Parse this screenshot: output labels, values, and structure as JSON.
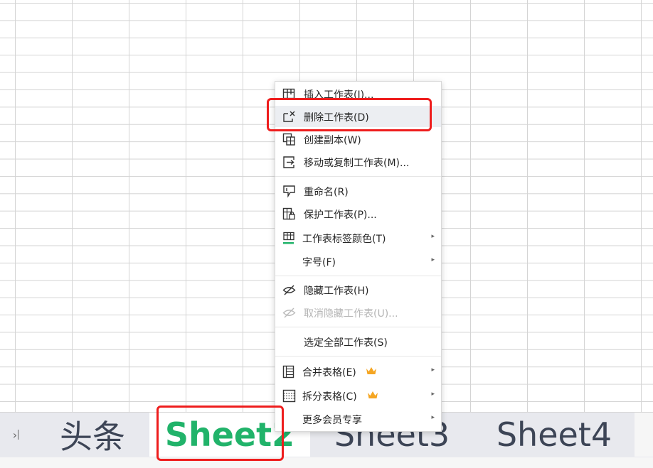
{
  "menu": {
    "items": [
      {
        "label": "插入工作表(I)...",
        "icon": "insert-sheet-icon"
      },
      {
        "label": "删除工作表(D)",
        "icon": "delete-sheet-icon",
        "state": "hover"
      },
      {
        "label": "创建副本(W)",
        "icon": "copy-sheet-icon"
      },
      {
        "label": "移动或复制工作表(M)...",
        "icon": "move-copy-sheet-icon"
      },
      {
        "label": "重命名(R)",
        "icon": "rename-icon"
      },
      {
        "label": "保护工作表(P)...",
        "icon": "protect-sheet-icon"
      },
      {
        "label": "工作表标签颜色(T)",
        "icon": "tab-color-icon",
        "submenu": true
      },
      {
        "label": "字号(F)",
        "submenu": true
      },
      {
        "label": "隐藏工作表(H)",
        "icon": "hide-eye-icon"
      },
      {
        "label": "取消隐藏工作表(U)...",
        "icon": "unhide-eye-icon",
        "disabled": true
      },
      {
        "label": "选定全部工作表(S)"
      },
      {
        "label": "合并表格(E)",
        "icon": "merge-table-icon",
        "premium": true,
        "submenu": true
      },
      {
        "label": "拆分表格(C)",
        "icon": "split-table-icon",
        "premium": true,
        "submenu": true
      },
      {
        "label": "更多会员专享",
        "submenu": true
      }
    ]
  },
  "tabs": [
    {
      "label": "头条"
    },
    {
      "label": "Sheet2",
      "active": true
    },
    {
      "label": "Sheet3"
    },
    {
      "label": "Sheet4"
    }
  ],
  "colors": {
    "active_tab": "#21b36a",
    "highlight": "#ee1d1d",
    "crown": "#f5a623",
    "tab_color_underline": "#21b36a"
  }
}
